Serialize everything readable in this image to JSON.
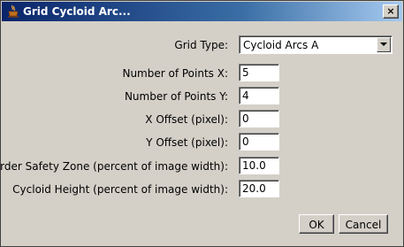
{
  "window": {
    "title": "Grid Cycloid Arc...",
    "close_symbol": "×",
    "icon": "java-cup-icon"
  },
  "form": {
    "grid_type": {
      "label": "Grid Type:",
      "value": "Cycloid Arcs A"
    },
    "points_x": {
      "label": "Number of Points X:",
      "value": "5"
    },
    "points_y": {
      "label": "Number of Points Y:",
      "value": "4"
    },
    "x_offset": {
      "label": "X Offset (pixel):",
      "value": "0"
    },
    "y_offset": {
      "label": "Y Offset (pixel):",
      "value": "0"
    },
    "border_zone": {
      "label": "Border Safety Zone (percent of image width):",
      "value": "10.0"
    },
    "cycloid_height": {
      "label": "Cycloid Height (percent of image width):",
      "value": "20.0"
    }
  },
  "buttons": {
    "ok": "OK",
    "cancel": "Cancel"
  }
}
